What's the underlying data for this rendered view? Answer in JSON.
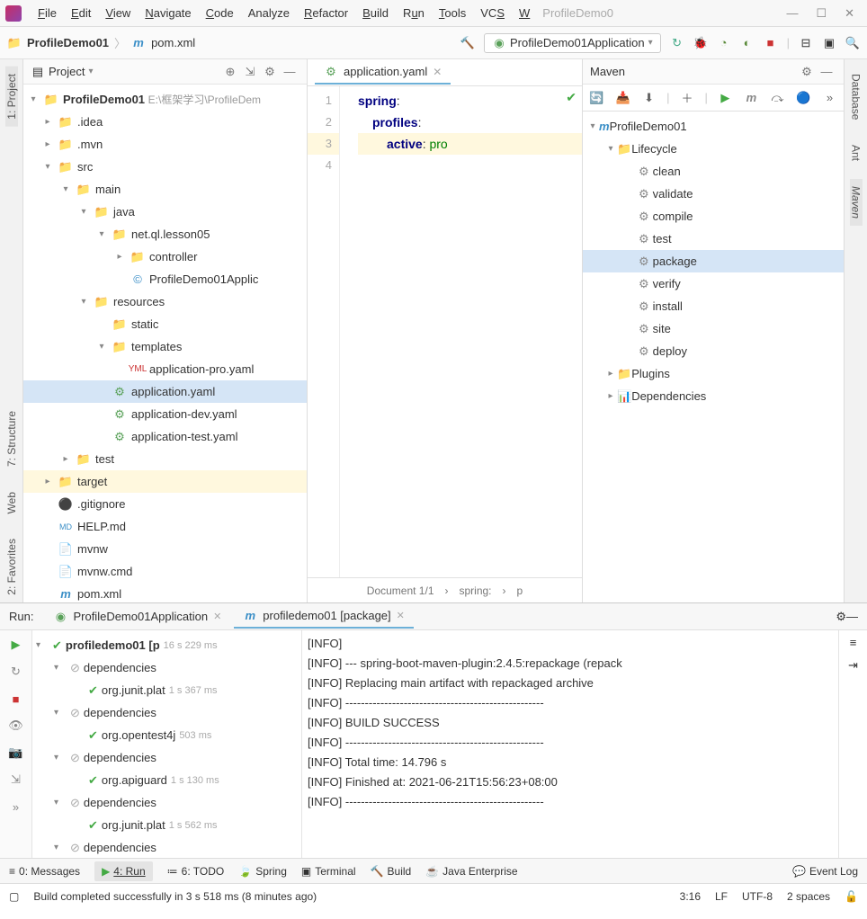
{
  "window": {
    "app_name": "ProfileDemo0"
  },
  "menu": {
    "file": "File",
    "edit": "Edit",
    "view": "View",
    "navigate": "Navigate",
    "code": "Code",
    "analyze": "Analyze",
    "refactor": "Refactor",
    "build": "Build",
    "run": "Run",
    "tools": "Tools",
    "vcs": "VCS",
    "window": "W"
  },
  "breadcrumb": {
    "root": "ProfileDemo01",
    "file": "pom.xml"
  },
  "run_config": "ProfileDemo01Application",
  "project": {
    "title": "Project",
    "root": "ProfileDemo01",
    "root_path": "E:\\框架学习\\ProfileDem",
    "items": {
      "idea": ".idea",
      "mvn": ".mvn",
      "src": "src",
      "main": "main",
      "java": "java",
      "pkg": "net.ql.lesson05",
      "controller": "controller",
      "app_class": "ProfileDemo01Applic",
      "resources": "resources",
      "static": "static",
      "templates": "templates",
      "app_pro": "application-pro.yaml",
      "app_yaml": "application.yaml",
      "app_dev": "application-dev.yaml",
      "app_test": "application-test.yaml",
      "testdir": "test",
      "target": "target",
      "gitignore": ".gitignore",
      "help": "HELP.md",
      "mvnw": "mvnw",
      "mvnwcmd": "mvnw.cmd",
      "pomxml": "pom.xml"
    }
  },
  "editor": {
    "tab": "application.yaml",
    "lines": [
      "1",
      "2",
      "3",
      "4"
    ],
    "l1_k": "spring",
    "l1_c": ":",
    "l2_k": "profiles",
    "l2_c": ":",
    "l3_k": "active",
    "l3_c": ": ",
    "l3_v": "pro",
    "status_doc": "Document 1/1",
    "status_crumb1": "spring:",
    "status_crumb2": "p"
  },
  "maven": {
    "title": "Maven",
    "root": "ProfileDemo01",
    "lifecycle": "Lifecycle",
    "goals": {
      "clean": "clean",
      "validate": "validate",
      "compile": "compile",
      "test": "test",
      "package": "package",
      "verify": "verify",
      "install": "install",
      "site": "site",
      "deploy": "deploy"
    },
    "plugins": "Plugins",
    "dependencies": "Dependencies"
  },
  "run": {
    "label": "Run:",
    "tab1": "ProfileDemo01Application",
    "tab2": "profiledemo01 [package]",
    "tree": {
      "root": "profiledemo01 [p",
      "root_time": "16 s 229 ms",
      "dep": "dependencies",
      "j1": "org.junit.plat",
      "j1_time": "1 s 367 ms",
      "j2": "org.opentest4j",
      "j2_time": "503 ms",
      "j3": "org.apiguard",
      "j3_time": "1 s 130 ms",
      "j4": "org.junit.plat",
      "j4_time": "1 s 562 ms"
    },
    "console": {
      "l1": "[INFO]",
      "l2": "[INFO] --- spring-boot-maven-plugin:2.4.5:repackage (repack",
      "l3": "[INFO] Replacing main artifact with repackaged archive",
      "l4": "[INFO] ---------------------------------------------------",
      "l5": "[INFO] BUILD SUCCESS",
      "l6": "[INFO] ---------------------------------------------------",
      "l7": "[INFO] Total time:  14.796 s",
      "l8": "[INFO] Finished at: 2021-06-21T15:56:23+08:00",
      "l9": "[INFO] ---------------------------------------------------"
    }
  },
  "sidebars": {
    "project": "1: Project",
    "structure": "7: Structure",
    "web": "Web",
    "favorites": "2: Favorites",
    "database": "Database",
    "ant": "Ant",
    "maven": "Maven"
  },
  "bottom": {
    "messages": "0: Messages",
    "run": "4: Run",
    "todo": "6: TODO",
    "spring": "Spring",
    "terminal": "Terminal",
    "build": "Build",
    "java_ee": "Java Enterprise",
    "event_log": "Event Log"
  },
  "status": {
    "message": "Build completed successfully in 3 s 518 ms (8 minutes ago)",
    "pos": "3:16",
    "le": "LF",
    "enc": "UTF-8",
    "indent": "2 spaces"
  }
}
